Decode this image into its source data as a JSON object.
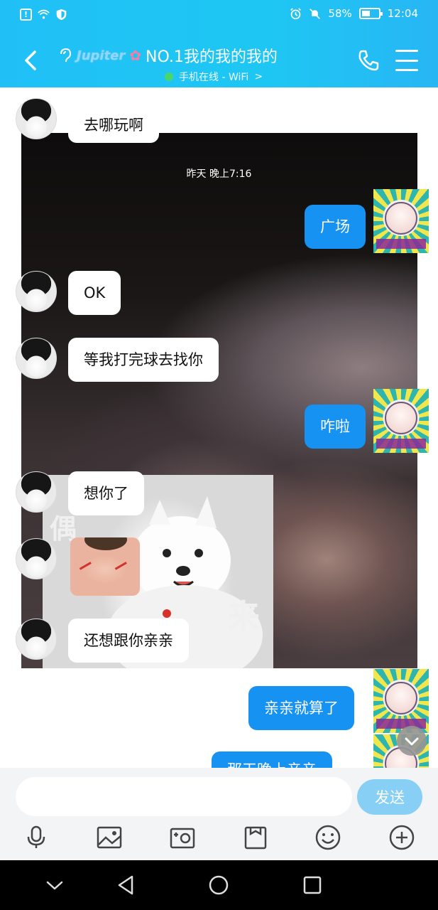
{
  "status_bar": {
    "battery_text": "58%",
    "battery_level": 0.58,
    "time": "12:04",
    "left_icons": [
      "alert-icon",
      "wifi-icon",
      "shield-icon"
    ],
    "right_icons": [
      "alarm-icon",
      "mute-icon"
    ]
  },
  "header": {
    "brand": "Jupiter",
    "title": "NO.1我的我的我的",
    "status": "手机在线 - WiFi",
    "status_arrow": ">",
    "accent_color": "#20c0f6"
  },
  "chat": {
    "timestamp": "昨天 晚上7:16",
    "background_text_left": "偶",
    "background_text_right": "来",
    "messages": [
      {
        "side": "in",
        "text": "去哪玩啊"
      },
      {
        "side": "out",
        "text": "广场"
      },
      {
        "side": "in",
        "text": "OK"
      },
      {
        "side": "in",
        "text": "等我打完球去找你"
      },
      {
        "side": "out",
        "text": "咋啦"
      },
      {
        "side": "in",
        "text": "想你了"
      },
      {
        "side": "in",
        "type": "sticker",
        "text": ""
      },
      {
        "side": "in",
        "text": "还想跟你亲亲"
      },
      {
        "side": "out",
        "text": "亲亲就算了"
      },
      {
        "side": "out",
        "text": "那天晚上亲亲"
      }
    ]
  },
  "input": {
    "placeholder": "",
    "send_label": "发送"
  },
  "toolbar": {
    "tools": [
      "microphone-icon",
      "image-icon",
      "camera-icon",
      "file-icon",
      "emoji-icon",
      "plus-icon"
    ]
  },
  "colors": {
    "out_bubble": "#1592f2",
    "send_button": "#87cff4"
  }
}
